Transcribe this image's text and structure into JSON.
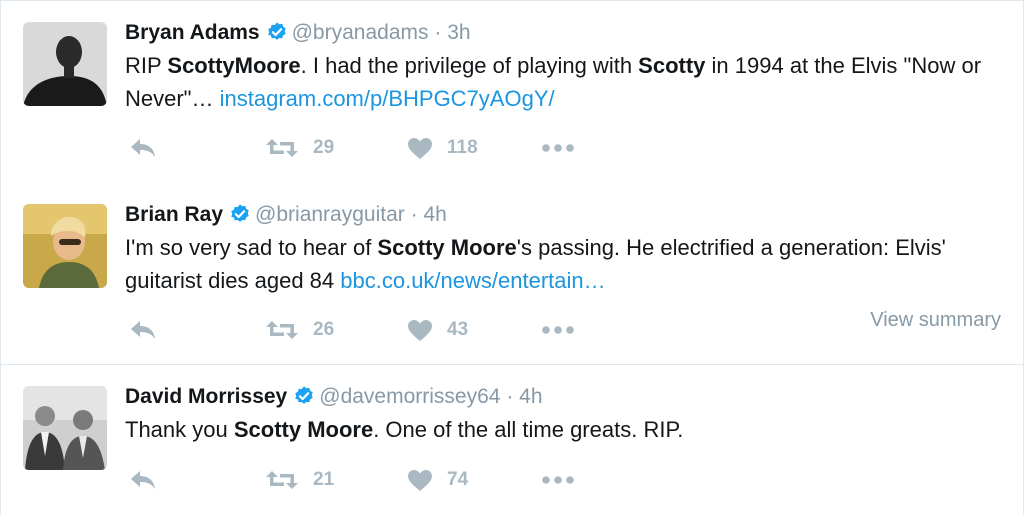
{
  "tweets": [
    {
      "name": "Bryan Adams",
      "handle": "@bryanadams",
      "time": "3h",
      "text_parts": [
        {
          "t": "RIP ",
          "b": false
        },
        {
          "t": "ScottyMoore",
          "b": true
        },
        {
          "t": ". I had the privilege of playing with ",
          "b": false
        },
        {
          "t": "Scotty",
          "b": true
        },
        {
          "t": " in 1994 at the Elvis \"Now or Never\"… ",
          "b": false
        }
      ],
      "link": "instagram.com/p/BHPGC7yAOgY/",
      "retweets": "29",
      "likes": "118"
    },
    {
      "name": "Brian Ray",
      "handle": "@brianrayguitar",
      "time": "4h",
      "text_parts": [
        {
          "t": "I'm so very sad to hear of ",
          "b": false
        },
        {
          "t": "Scotty Moore",
          "b": true
        },
        {
          "t": "'s passing. He electrified a generation: Elvis' guitarist dies aged 84 ",
          "b": false
        }
      ],
      "link": "bbc.co.uk/news/entertain…",
      "retweets": "26",
      "likes": "43",
      "summary": "View summary"
    },
    {
      "name": "David Morrissey",
      "handle": "@davemorrissey64",
      "time": "4h",
      "text_parts": [
        {
          "t": "Thank you ",
          "b": false
        },
        {
          "t": "Scotty Moore",
          "b": true
        },
        {
          "t": ". One of the all time greats. RIP.",
          "b": false
        }
      ],
      "link": "",
      "retweets": "21",
      "likes": "74"
    }
  ],
  "dot": "·",
  "colors": {
    "verified": "#1da1f2",
    "link": "#1b95e0",
    "muted": "#8899a6",
    "icon": "#aab8c2"
  }
}
